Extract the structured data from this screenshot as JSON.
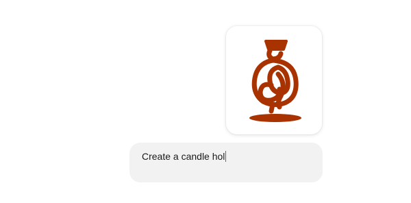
{
  "attachment": {
    "icon": "candle-holder-sketch",
    "stroke_color": "#a83200"
  },
  "composer": {
    "value": "Create a candle hol",
    "caret_color": "#1a73e8"
  }
}
